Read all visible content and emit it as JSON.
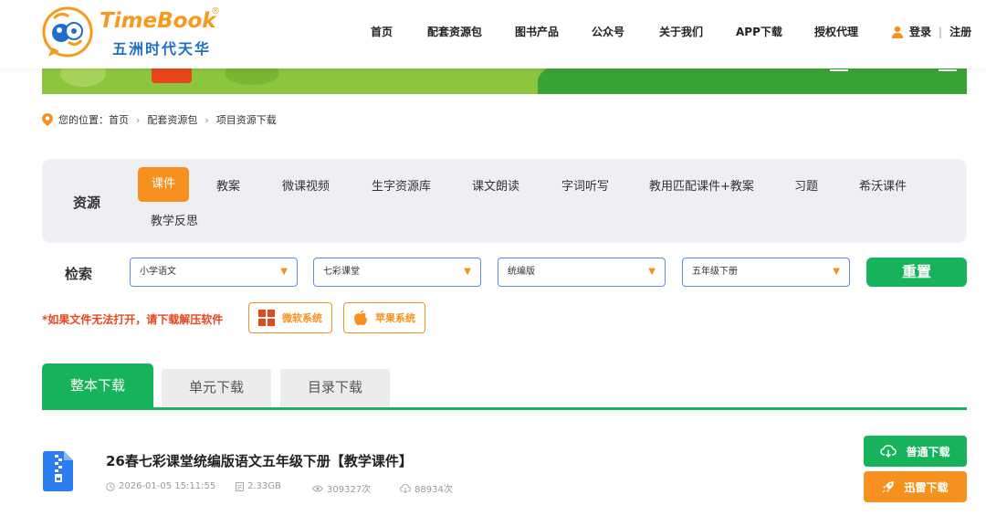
{
  "logo": {
    "en": "TimeBook",
    "reg": "®",
    "cn": "五洲时代天华"
  },
  "nav": [
    "首页",
    "配套资源包",
    "图书产品",
    "公众号",
    "关于我们",
    "APP下载",
    "授权代理"
  ],
  "auth": {
    "login": "登录",
    "register": "注册"
  },
  "breadcrumb": {
    "prefix": "您的位置：",
    "items": [
      "首页",
      "配套资源包",
      "项目资源下载"
    ]
  },
  "resource_filter": {
    "label": "资源",
    "tabs": [
      "课件",
      "教案",
      "微课视频",
      "生字资源库",
      "课文朗读",
      "字词听写",
      "教用匹配课件+教案",
      "习题",
      "希沃课件",
      "教学反思"
    ],
    "active_index": 0
  },
  "search": {
    "label": "检索",
    "selects": [
      "小学语文",
      "七彩课堂",
      "统编版",
      "五年级下册"
    ],
    "reset_label": "重置"
  },
  "tip": {
    "text": "*如果文件无法打开，请下载解压软件",
    "windows_label": "微软系统",
    "apple_label": "苹果系统"
  },
  "download_tabs": [
    "整本下载",
    "单元下载",
    "目录下载"
  ],
  "item": {
    "title": "26春七彩课堂统编版语文五年级下册【教学课件】",
    "date": "2026-01-05 15:11:55",
    "size": "2.33GB",
    "views": "309327次",
    "downloads": "88934次",
    "normal_download": "普通下载",
    "thunder_download": "迅雷下载"
  },
  "colors": {
    "green": "#17b35b",
    "orange": "#f6901e",
    "red": "#e8461b",
    "blue": "#1f6fc9"
  }
}
